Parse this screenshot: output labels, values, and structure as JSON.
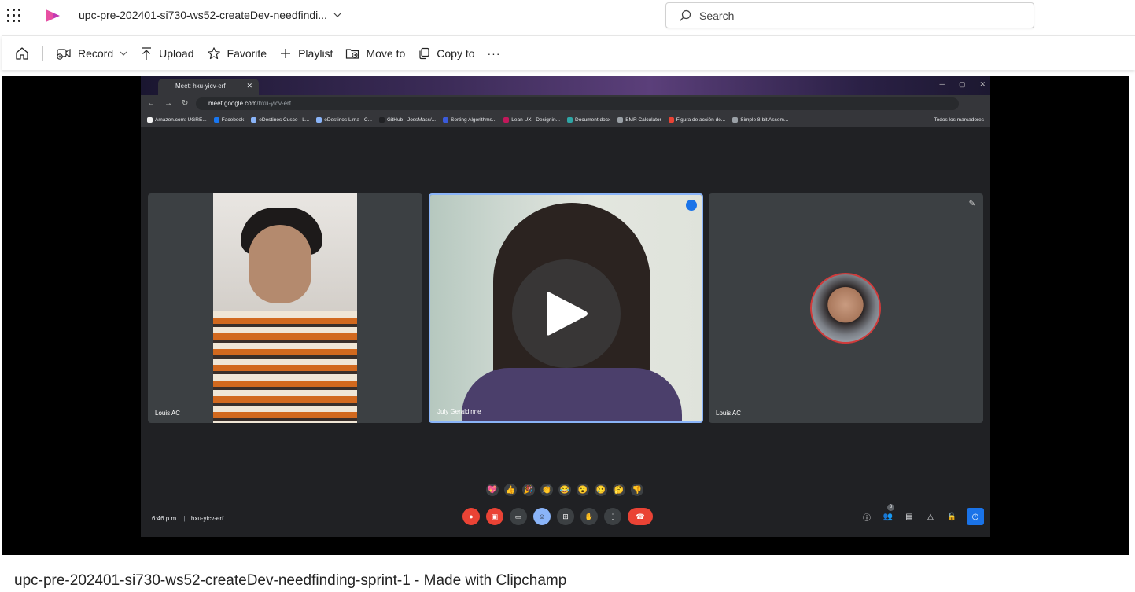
{
  "header": {
    "doc_title": "upc-pre-202401-si730-ws52-createDev-needfindi...",
    "search_placeholder": "Search"
  },
  "toolbar": {
    "record": "Record",
    "upload": "Upload",
    "favorite": "Favorite",
    "playlist": "Playlist",
    "move_to": "Move to",
    "copy_to": "Copy to",
    "more": "···"
  },
  "browser": {
    "tab_title": "Meet: hxu-yicv-erf",
    "url_host": "meet.google.com",
    "url_path": "/hxu-yicv-erf",
    "bookmarks": [
      {
        "label": "Amazon.com: UGRE...",
        "color": "#f2f2f2"
      },
      {
        "label": "Facebook",
        "color": "#1877f2"
      },
      {
        "label": "eDestinos Cusco - L...",
        "color": "#8ab4f8"
      },
      {
        "label": "eDestinos Lima - C...",
        "color": "#8ab4f8"
      },
      {
        "label": "GitHub - JossMass/...",
        "color": "#202124"
      },
      {
        "label": "Sorting Algorithms...",
        "color": "#3b5bdb"
      },
      {
        "label": "Lean UX - Designin...",
        "color": "#c2185b"
      },
      {
        "label": "Document.docx",
        "color": "#2ea6a6"
      },
      {
        "label": "BMR Calculator",
        "color": "#9aa0a6"
      },
      {
        "label": "Figura de acción de...",
        "color": "#ea4335"
      },
      {
        "label": "Simple 8-bit Assem...",
        "color": "#9aa0a6"
      }
    ],
    "all_bookmarks": "Todos los marcadores"
  },
  "meet": {
    "participants": [
      "Louis AC",
      "July Geraldinne",
      "Louis AC"
    ],
    "time": "6:46 p.m.",
    "code": "hxu-yicv-erf",
    "participant_count": "3",
    "reactions": [
      "💖",
      "👍",
      "🎉",
      "👏",
      "😂",
      "😮",
      "😢",
      "🤔",
      "👎"
    ]
  },
  "video": {
    "title": "upc-pre-202401-si730-ws52-createDev-needfinding-sprint-1 - Made with Clipchamp"
  },
  "colors": {
    "accent": "#c239b3",
    "meet_red": "#ea4335",
    "meet_blue": "#1a73e8"
  }
}
